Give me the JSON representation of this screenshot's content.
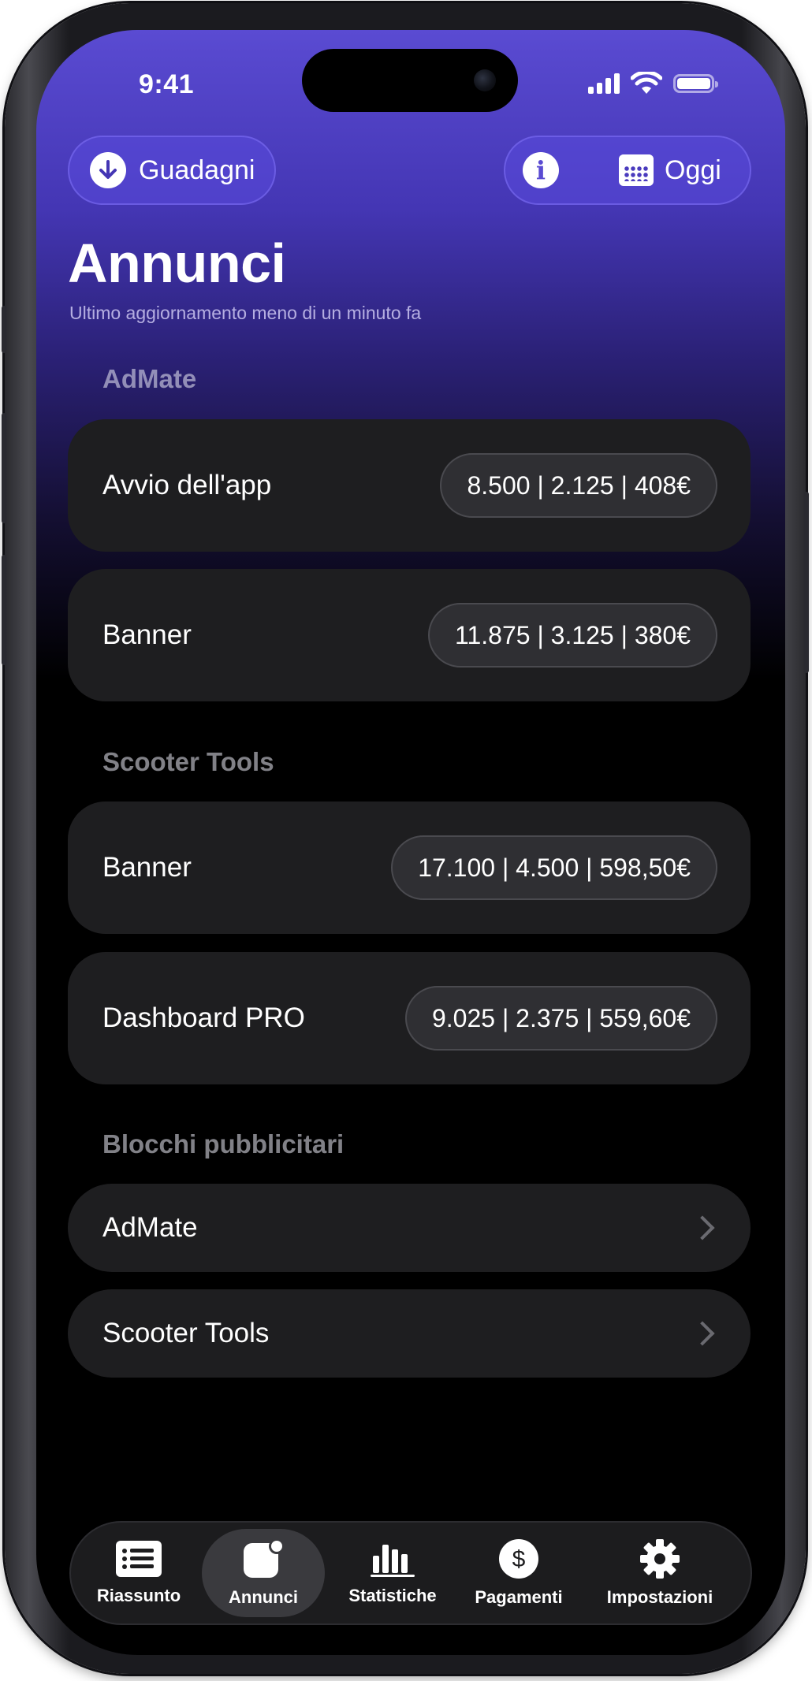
{
  "status_bar": {
    "time": "9:41"
  },
  "header": {
    "earnings_label": "Guadagni",
    "today_label": "Oggi"
  },
  "page": {
    "title": "Annunci",
    "subtitle": "Ultimo aggiornamento meno di un minuto fa"
  },
  "sections": [
    {
      "title": "AdMate",
      "rows": [
        {
          "label": "Avvio dell'app",
          "stats": "8.500 | 2.125 | 408€"
        },
        {
          "label": "Banner",
          "stats": "11.875 | 3.125 | 380€"
        }
      ]
    },
    {
      "title": "Scooter Tools",
      "rows": [
        {
          "label": "Banner",
          "stats": "17.100 | 4.500 | 598,50€"
        },
        {
          "label": "Dashboard PRO",
          "stats": "9.025 | 2.375 | 559,60€"
        }
      ]
    },
    {
      "title": "Blocchi pubblicitari",
      "links": [
        {
          "label": "AdMate"
        },
        {
          "label": "Scooter Tools"
        }
      ]
    }
  ],
  "tabs": [
    {
      "label": "Riassunto",
      "icon": "list-icon"
    },
    {
      "label": "Annunci",
      "icon": "ads-icon",
      "active": true
    },
    {
      "label": "Statistiche",
      "icon": "bar-chart-icon"
    },
    {
      "label": "Pagamenti",
      "icon": "dollar-icon"
    },
    {
      "label": "Impostazioni",
      "icon": "gear-icon"
    }
  ],
  "colors": {
    "accent": "#5a4bd2",
    "card": "#1e1e20",
    "background": "#000000"
  }
}
